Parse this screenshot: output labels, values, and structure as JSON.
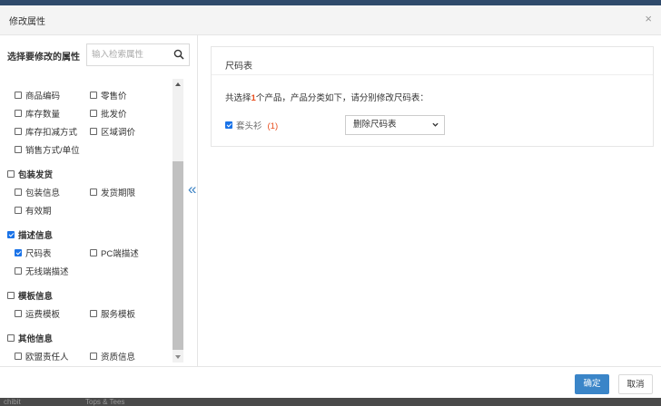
{
  "dialog": {
    "title": "修改属性",
    "close_glyph": "×"
  },
  "left": {
    "title": "选择要修改的属性",
    "search_placeholder": "输入检索属性"
  },
  "groups": [
    {
      "items": [
        {
          "label": "商品编码",
          "checked": false
        },
        {
          "label": "零售价",
          "checked": false
        },
        {
          "label": "库存数量",
          "checked": false
        },
        {
          "label": "批发价",
          "checked": false
        },
        {
          "label": "库存扣减方式",
          "checked": false
        },
        {
          "label": "区域调价",
          "checked": false
        },
        {
          "label": "销售方式/单位",
          "checked": false
        }
      ]
    },
    {
      "header": {
        "label": "包装发货",
        "checked": false
      },
      "items": [
        {
          "label": "包装信息",
          "checked": false
        },
        {
          "label": "发货期限",
          "checked": false
        },
        {
          "label": "有效期",
          "checked": false
        }
      ]
    },
    {
      "header": {
        "label": "描述信息",
        "checked": true
      },
      "items": [
        {
          "label": "尺码表",
          "checked": true
        },
        {
          "label": "PC端描述",
          "checked": false
        },
        {
          "label": "无线端描述",
          "checked": false
        }
      ]
    },
    {
      "header": {
        "label": "模板信息",
        "checked": false
      },
      "items": [
        {
          "label": "运费模板",
          "checked": false
        },
        {
          "label": "服务模板",
          "checked": false
        }
      ]
    },
    {
      "header": {
        "label": "其他信息",
        "checked": false
      },
      "items": [
        {
          "label": "欧盟责任人",
          "checked": false
        },
        {
          "label": "资质信息",
          "checked": false
        }
      ]
    }
  ],
  "collapse_glyph": "«",
  "right": {
    "title": "尺码表",
    "desc_prefix": "共选择",
    "desc_count": "1",
    "desc_suffix": "个产品，产品分类如下，请分别修改尺码表：",
    "product": {
      "label": "套头衫",
      "count": "(1)",
      "checked": true
    },
    "select_value": "删除尺码表"
  },
  "footer": {
    "ok_label": "确定",
    "cancel_label": "取消"
  },
  "background": {
    "left_text": "chibit",
    "mid_text": "Tops & Tees"
  },
  "colors": {
    "accent": "#3a85c8",
    "count": "#e84d1c",
    "checkbox": "#1a73e8"
  }
}
